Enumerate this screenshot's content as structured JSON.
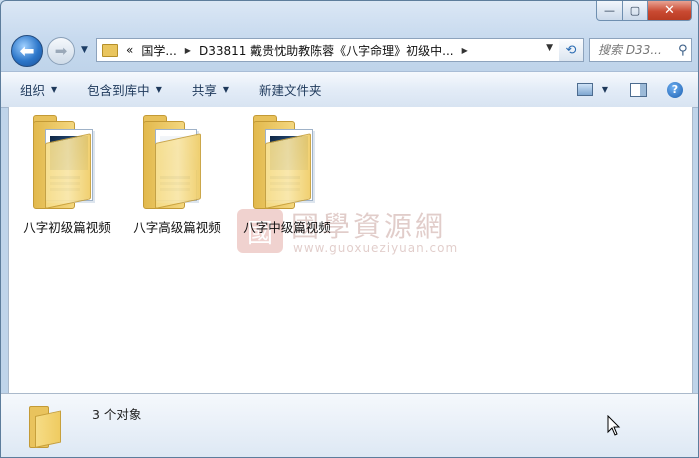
{
  "window": {
    "caption": {
      "minimize": "—",
      "maximize": "▢",
      "close": "✕"
    }
  },
  "nav": {
    "back_glyph": "⬅",
    "forward_glyph": "➡",
    "breadcrumb": [
      "«",
      "国学...",
      "D33811 戴贵忱助教陈蓉《八字命理》初级中..."
    ],
    "search_placeholder": "搜索 D33...",
    "refresh_glyph": "⟲"
  },
  "toolbar": {
    "organize": "组织",
    "include_library": "包含到库中",
    "share": "共享",
    "new_folder": "新建文件夹"
  },
  "files": [
    {
      "name": "八字初级篇视频",
      "style": "photo"
    },
    {
      "name": "八字高级篇视频",
      "style": "plain"
    },
    {
      "name": "八字中级篇视频",
      "style": "photo"
    }
  ],
  "watermark": {
    "seal": "國",
    "title": "國學資源網",
    "url": "www.guoxueziyuan.com"
  },
  "status": {
    "count": "3 个对象"
  },
  "colors": {
    "folder": "#f4d77f",
    "accent": "#2c76c9",
    "close": "#c94a32"
  }
}
